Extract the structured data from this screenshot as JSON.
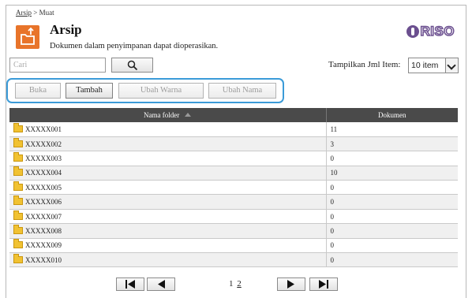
{
  "breadcrumb": {
    "link": "Arsip",
    "separator": ">",
    "current": "Muat"
  },
  "header": {
    "title": "Arsip",
    "subtitle": "Dokumen dalam penyimpanan dapat dioperasikan.",
    "logo_text": "RISO",
    "icon": "upload-folder-icon"
  },
  "search": {
    "placeholder": "Cari",
    "button_icon": "search-icon"
  },
  "items_per_page": {
    "label": "Tampilkan Jml Item:",
    "selected": "10 item"
  },
  "toolbar": {
    "open_label": "Buka",
    "add_label": "Tambah",
    "change_color_label": "Ubah Warna",
    "rename_label": "Ubah Nama",
    "highlight_color": "#3b9bd8"
  },
  "table": {
    "headers": {
      "name": "Nama folder",
      "documents": "Dokumen"
    },
    "rows": [
      {
        "name": "XXXXX001",
        "documents": "11"
      },
      {
        "name": "XXXXX002",
        "documents": "3"
      },
      {
        "name": "XXXXX003",
        "documents": "0"
      },
      {
        "name": "XXXXX004",
        "documents": "10"
      },
      {
        "name": "XXXXX005",
        "documents": "0"
      },
      {
        "name": "XXXXX006",
        "documents": "0"
      },
      {
        "name": "XXXXX007",
        "documents": "0"
      },
      {
        "name": "XXXXX008",
        "documents": "0"
      },
      {
        "name": "XXXXX009",
        "documents": "0"
      },
      {
        "name": "XXXXX010",
        "documents": "0"
      }
    ]
  },
  "pagination": {
    "current": "1",
    "next": "2"
  },
  "colors": {
    "accent": "#e8742a",
    "header_bg": "#4a4a4a",
    "brand": "#6b4f8f"
  }
}
